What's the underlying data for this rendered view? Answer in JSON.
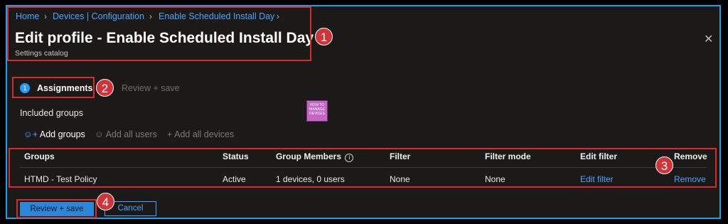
{
  "breadcrumb": [
    "Home",
    "Devices | Configuration",
    "Enable Scheduled Install Day"
  ],
  "title": "Edit profile - Enable Scheduled Install Day",
  "subtitle": "Settings catalog",
  "steps": [
    {
      "number": "1",
      "label": "Assignments"
    },
    {
      "label": "Review + save"
    }
  ],
  "included_groups_label": "Included groups",
  "actions": [
    {
      "label": "Add groups",
      "icon": "add-user-icon"
    },
    {
      "label": "Add all users",
      "icon": "all-users-icon"
    },
    {
      "label": "Add all devices",
      "icon": "plus-icon"
    }
  ],
  "table": {
    "headers": [
      "Groups",
      "Status",
      "Group Members",
      "Filter",
      "Filter mode",
      "Edit filter",
      "Remove"
    ],
    "rows": [
      {
        "group": "HTMD - Test Policy",
        "status": "Active",
        "members": "1 devices, 0 users",
        "filter": "None",
        "filter_mode": "None",
        "edit_filter": "Edit filter",
        "remove": "Remove"
      }
    ]
  },
  "buttons": {
    "review_save": "Review + save",
    "cancel": "Cancel"
  },
  "callouts": [
    "1",
    "2",
    "3",
    "4"
  ],
  "logo_text": "HOW TO MANAGE DEVICES",
  "colors": {
    "accent": "#1aa3ea",
    "link": "#4aa3ff",
    "annotation": "#d62c2c",
    "background": "#1b1a19"
  }
}
